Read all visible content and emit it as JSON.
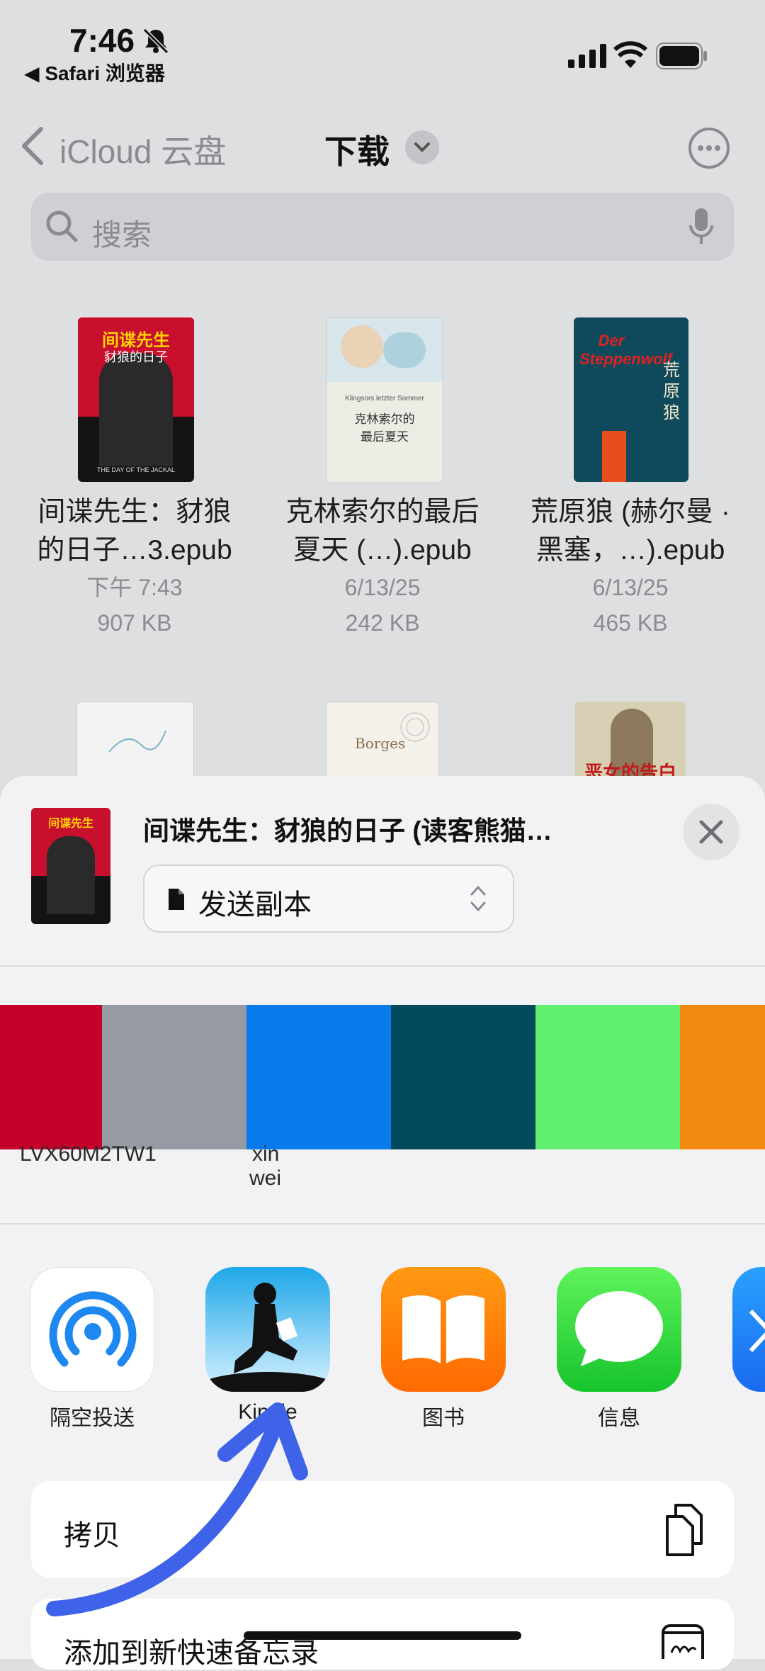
{
  "status_bar": {
    "time": "7:46",
    "back_app": "◀ Safari 浏览器"
  },
  "nav": {
    "back_label": "iCloud 云盘",
    "title": "下载"
  },
  "search": {
    "placeholder": "搜索"
  },
  "files": [
    {
      "name_line1": "间谍先生：豺狼",
      "name_line2": "的日子…3.epub",
      "date": "下午 7:43",
      "size": "907 KB",
      "cover_title": "间谍先生",
      "cover_sub": "豺狼的日子",
      "cover_foot": "THE DAY OF THE JACKAL"
    },
    {
      "name_line1": "克林索尔的最后",
      "name_line2": "夏天 (…).epub",
      "date": "6/13/25",
      "size": "242 KB",
      "cover_title": "克林索尔的最后夏天",
      "cover_sub": "Klingsors letzter Sommer"
    },
    {
      "name_line1": "荒原狼 (赫尔曼 ·",
      "name_line2": "黑塞，…).epub",
      "date": "6/13/25",
      "size": "465 KB",
      "cover_title": "荒原狼",
      "cover_sub": "Der Steppenwolf"
    }
  ],
  "files_row2": [
    {
      "cover_text": ""
    },
    {
      "cover_text": "Borges"
    },
    {
      "cover_text": "恶女的告白"
    }
  ],
  "share_sheet": {
    "title": "间谍先生：豺狼的日子 (读客熊猫…",
    "send_option": "发送副本",
    "contacts": [
      {
        "name": "LVX60M2TW1"
      },
      {
        "name_line1": "xin",
        "name_line2": "wei"
      }
    ],
    "apps": [
      {
        "label": "隔空投送",
        "icon": "airdrop-icon"
      },
      {
        "label": "Kindle",
        "icon": "kindle-icon"
      },
      {
        "label": "图书",
        "icon": "books-icon"
      },
      {
        "label": "信息",
        "icon": "messages-icon"
      }
    ],
    "actions": [
      {
        "label": "拷贝",
        "icon": "copy-icon"
      },
      {
        "label": "添加到新快速备忘录",
        "icon": "quick-note-icon"
      }
    ],
    "strip_colors": [
      "#c4002b",
      "#969aa3",
      "#0a7bea",
      "#024a5c",
      "#62f071",
      "#f28a12"
    ]
  }
}
